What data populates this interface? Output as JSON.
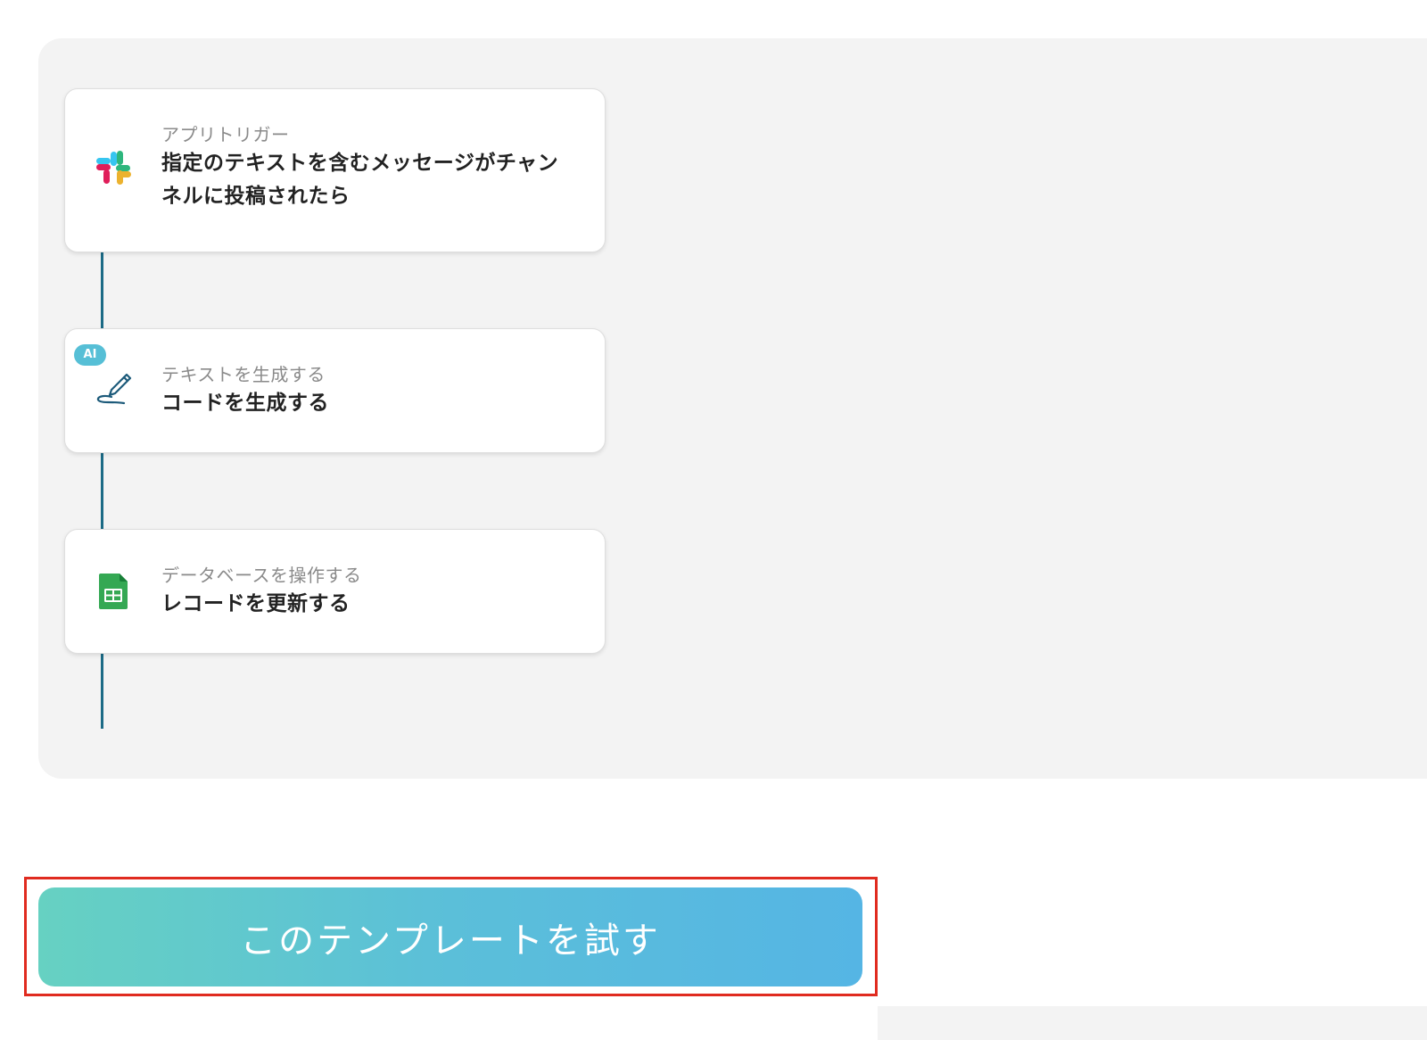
{
  "flow": {
    "steps": [
      {
        "type_label": "アプリトリガー",
        "title_lines": [
          "指定のテキストを含むメッセージがチャン",
          "ネルに投稿されたら"
        ],
        "icon": "slack-icon",
        "badge": ""
      },
      {
        "type_label": "テキストを生成する",
        "title_lines": [
          "コードを生成する"
        ],
        "icon": "pen-signature-icon",
        "badge": "AI"
      },
      {
        "type_label": "データベースを操作する",
        "title_lines": [
          "レコードを更新する"
        ],
        "icon": "google-sheets-icon",
        "badge": ""
      }
    ]
  },
  "cta": {
    "label": "このテンプレートを試す"
  },
  "colors": {
    "connector": "#1c6b86",
    "panel_background": "#f3f3f3",
    "button_gradient_start": "#66d1c2",
    "button_gradient_end": "#55b5e4",
    "highlight_border": "#e02b1f",
    "ai_badge": "#56bfd6"
  }
}
